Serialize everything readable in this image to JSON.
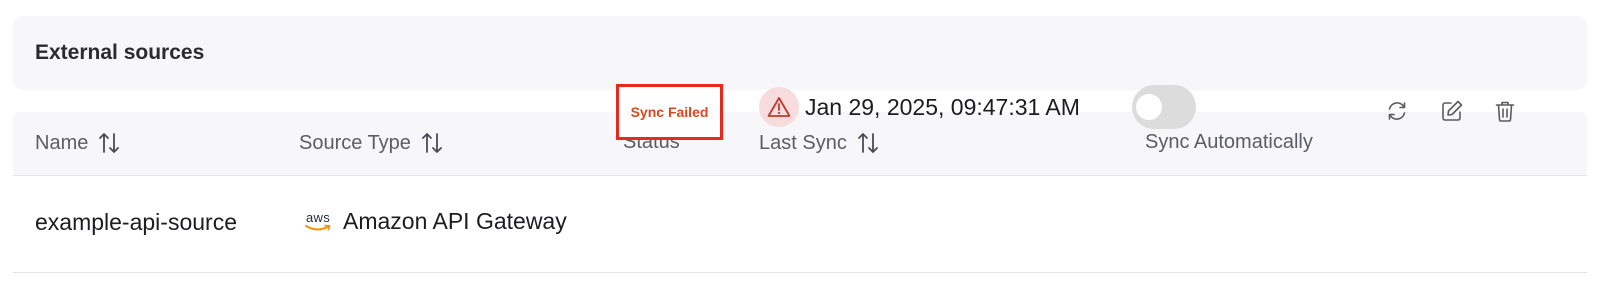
{
  "header": {
    "title": "External sources"
  },
  "table": {
    "columns": [
      {
        "label": "Name",
        "sortable": true
      },
      {
        "label": "Source Type",
        "sortable": true
      },
      {
        "label": "Status",
        "sortable": false
      },
      {
        "label": "Last Sync",
        "sortable": true
      },
      {
        "label": "Sync Automatically",
        "sortable": false
      }
    ],
    "rows": [
      {
        "name": "example-api-source",
        "source_type": "Amazon API Gateway",
        "source_logo": "aws",
        "status": "Sync Failed",
        "status_color": "#d9491d",
        "last_sync": "Jan 29, 2025, 09:47:31 AM",
        "last_sync_icon": "warning-icon",
        "sync_automatically": false,
        "actions": [
          "sync-icon",
          "edit-icon",
          "trash-icon"
        ]
      }
    ]
  },
  "colors": {
    "header_bg": "#f7f7f9",
    "status_border": "#e8291c",
    "warning_bg": "#f6dcdc",
    "warning_icon": "#c0392b",
    "toggle_off": "#dcdcdc"
  }
}
